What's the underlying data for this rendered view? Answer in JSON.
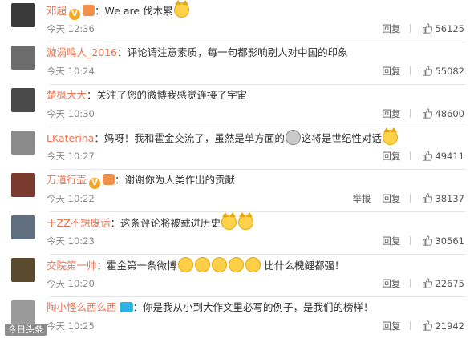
{
  "comments": [
    {
      "username": "邓超",
      "badges": [
        "v-badge",
        "medal-badge"
      ],
      "text": "We are 伐木累",
      "emojis_after": [
        "cat"
      ],
      "emojis_mid": [],
      "text_after": "",
      "time": "今天 12:36",
      "reply_label": "回复",
      "report_label": "",
      "likes": "56125",
      "avatar_color": "#3a3a3a"
    },
    {
      "username": "漩涡鸣人_2016",
      "badges": [],
      "text": "评论请注意素质，每一句都影响别人对中国的印象",
      "emojis_after": [],
      "emojis_mid": [],
      "text_after": "",
      "time": "今天 10:24",
      "reply_label": "回复",
      "report_label": "",
      "likes": "55082",
      "avatar_color": "#6d6d6d"
    },
    {
      "username": "楚枫大大",
      "badges": [],
      "text": "关注了您的微博我感觉连接了宇宙",
      "emojis_after": [],
      "emojis_mid": [],
      "text_after": "",
      "time": "今天 10:30",
      "reply_label": "回复",
      "report_label": "",
      "likes": "48600",
      "avatar_color": "#4a4a4a"
    },
    {
      "username": "LKaterina",
      "badges": [],
      "text": "妈呀！我和霍金交流了，虽然是单方面的",
      "emojis_mid": [
        "sad"
      ],
      "text_after": "这将是世纪性对话",
      "emojis_after": [
        "cat"
      ],
      "time": "今天 10:27",
      "reply_label": "回复",
      "report_label": "",
      "likes": "49411",
      "avatar_color": "#8a8a8a"
    },
    {
      "username": "万道行壶",
      "badges": [
        "v-badge",
        "medal-badge"
      ],
      "text": "谢谢你为人类作出的贡献",
      "emojis_after": [],
      "emojis_mid": [],
      "text_after": "",
      "time": "今天 10:22",
      "reply_label": "回复",
      "report_label": "举报",
      "likes": "38137",
      "avatar_color": "#7a3b2e"
    },
    {
      "username": "于ZZ不想废话",
      "badges": [],
      "text": "这条评论将被载进历史",
      "emojis_after": [
        "cat",
        "cat"
      ],
      "emojis_mid": [],
      "text_after": "",
      "time": "今天 10:23",
      "reply_label": "回复",
      "report_label": "",
      "likes": "30561",
      "avatar_color": "#5f6f7f"
    },
    {
      "username": "交院第一帅",
      "badges": [],
      "text": "霍金第一条微博",
      "emojis_mid": [
        "cry",
        "cry",
        "cry",
        "cry",
        "cry"
      ],
      "text_after": " 比什么槐鲤都强！",
      "emojis_after": [],
      "time": "今天 10:20",
      "reply_label": "回复",
      "report_label": "",
      "likes": "22675",
      "avatar_color": "#5a4a2e"
    },
    {
      "username": "陶小怪么西么西",
      "badges": [
        "camera-badge"
      ],
      "text": "你是我从小到大作文里必写的例子，是我们的榜样！",
      "emojis_after": [],
      "emojis_mid": [],
      "text_after": "",
      "time": "今天 10:25",
      "reply_label": "回复",
      "report_label": "",
      "likes": "21942",
      "avatar_color": "#9a9a9a"
    }
  ],
  "colors": {
    "username": "#eb7350",
    "time": "#8a8a8a",
    "text": "#333333"
  },
  "icons": {
    "like": "thumbs-up-icon",
    "v_badge": "verified-v-icon",
    "medal": "medal-icon",
    "camera": "camera-icon"
  },
  "watermark": "今日头条"
}
